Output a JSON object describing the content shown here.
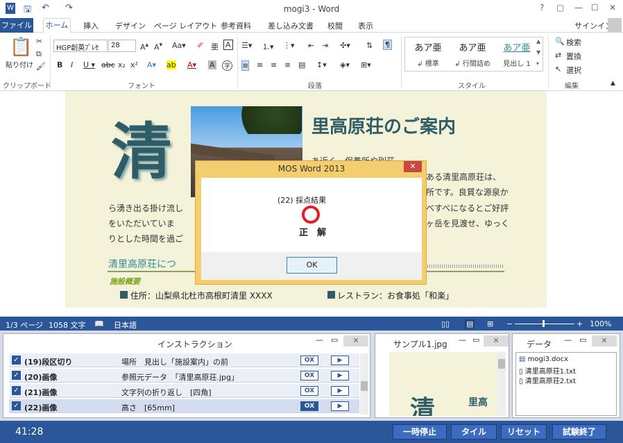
{
  "app": {
    "document_title": "mogi3 - Word",
    "signin": "サインイン",
    "window_buttons": [
      "?",
      "▢",
      "—",
      "☐",
      "✕"
    ]
  },
  "ribbon_tabs": [
    "ファイル",
    "ホーム",
    "挿入",
    "デザイン",
    "ページ レイアウト",
    "参考資料",
    "差し込み文書",
    "校閲",
    "表示"
  ],
  "ribbon": {
    "paste_label": "貼り付け",
    "font_name": "HGP創英ﾌﾟﾚｾ",
    "font_size": "28",
    "group_clipboard": "クリップボード",
    "group_font": "フォント",
    "group_paragraph": "段落",
    "group_style": "スタイル",
    "group_edit": "編集",
    "styles": [
      {
        "sample": "あア亜",
        "name": "↲ 標準"
      },
      {
        "sample": "あア亜",
        "name": "↲ 行間詰め"
      },
      {
        "sample": "あア亜",
        "name": "見出し 1"
      }
    ],
    "edit_search": "検索",
    "edit_replace": "置換",
    "edit_select": "選択"
  },
  "document": {
    "big_kanji": "清",
    "heading": "里高原荘のご案内",
    "text_right": [
      "あ近く、保養所や別荘",
      "ある清里高原荘は、",
      "所です。良質な源泉か",
      "べすべになるとご好評",
      "ヶ岳を見渡せ、ゆっく"
    ],
    "text_left": [
      "ら湧き出る掛け流し",
      "をいただいていま",
      "りとした時間を過ご"
    ],
    "section_heading": "清里高原荘につ",
    "facilities_label": "施設概要",
    "address": "住所：山梨県北杜市高根町清里 XXXX",
    "restaurant": "レストラン：お食事処「和楽」"
  },
  "dialog": {
    "title": "MOS Word 2013",
    "close": "✕",
    "result_label": "(22) 採点結果",
    "result_text": "正　解",
    "ok": "OK"
  },
  "statusbar": {
    "page": "1/3 ページ",
    "words": "1058 文字",
    "language": "日本語",
    "zoom": "100%"
  },
  "instruction_panel": {
    "title": "インストラクション",
    "rows": [
      {
        "name": "(19)段区切り",
        "desc": "場所　見出し「施設案内」の前"
      },
      {
        "name": "(20)画像",
        "desc": "参照元データ　「清里高原荘.jpg」"
      },
      {
        "name": "(21)画像",
        "desc": "文字列の折り返し　[四角]"
      },
      {
        "name": "(22)画像",
        "desc": "高さ　[65mm]"
      }
    ],
    "ox_label": "OX",
    "play_label": "▶"
  },
  "sample_panel": {
    "title": "サンプル1.jpg",
    "preview_kanji": "清",
    "preview_text": "里高"
  },
  "data_panel": {
    "title": "データ",
    "files": [
      "mogi3.docx",
      "清里高原荘1.txt",
      "清里高原荘2.txt"
    ]
  },
  "footer": {
    "timer": "41:28",
    "buttons": [
      "一時停止",
      "タイル",
      "リセット",
      "試験終了"
    ]
  }
}
